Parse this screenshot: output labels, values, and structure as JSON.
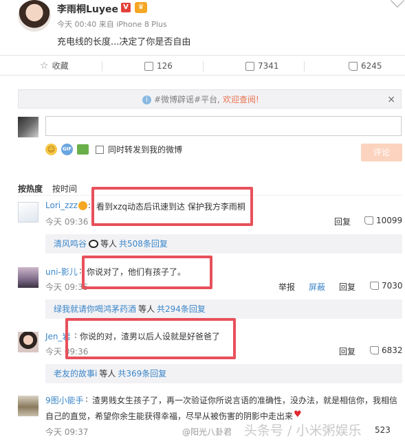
{
  "post": {
    "author": "李雨桐Luyee",
    "vip_badge": "V",
    "meta": "今天 00:40 来自 iPhone 8 Plus",
    "text": "充电线的长度...决定了你是否自由"
  },
  "actions": {
    "favorite": "收藏",
    "repost": "126",
    "comment": "7341",
    "like": "6245"
  },
  "notice": {
    "prefix": "#微博辟谣#平台,",
    "link": "欢迎查阅!",
    "close": "×"
  },
  "composer": {
    "gif_label": "GIF",
    "repost_checkbox_label": "同时转发到我的微博",
    "submit_label": "评论"
  },
  "sort": {
    "hot": "按热度",
    "time": "按时间"
  },
  "comments": [
    {
      "user": "Lori_zzz",
      "text": "看到xzq动态后讯速到达 保护我方李雨桐",
      "time": "今天 09:36",
      "reply": "回复",
      "likes": "10099",
      "thread": {
        "user": "清风鸣谷",
        "etc": "等人",
        "count": "共508条回复"
      }
    },
    {
      "user": "uni-影儿",
      "text": "你说对了，他们有孩子了。",
      "time": "今天 09:35",
      "report": "举报",
      "block": "屏蔽",
      "reply": "回复",
      "likes": "7030",
      "thread": {
        "user": "绿我就请你喝鸿茅药酒",
        "etc": "等人",
        "count": "共294条回复"
      }
    },
    {
      "user": "Jen_岩",
      "text": "你说的对，渣男以后人设就是好爸爸了",
      "time": "今天 09:36",
      "reply": "回复",
      "likes": "6832",
      "thread": {
        "user": "老友的故事i",
        "etc": "等人",
        "count": "共369条回复"
      }
    },
    {
      "user": "9图小能手",
      "text_line1": "渣男贱女生孩子了，再一次验证你所说言语的准确性，没办法，就是相信你，我相信",
      "text_line2": "自己的直觉，希望你余生能获得幸福，尽早从被伤害的阴影中走出来",
      "time": "今天 09:37",
      "likes": "523"
    }
  ],
  "watermark": {
    "small": "@阳光八卦君",
    "big": "头条号 / 小米粥娱乐"
  },
  "colors": {
    "link_blue": "#3b86c8",
    "accent_orange": "#eb7350",
    "highlight_red": "#e8505b",
    "submit_disabled": "#fbd3bf"
  }
}
